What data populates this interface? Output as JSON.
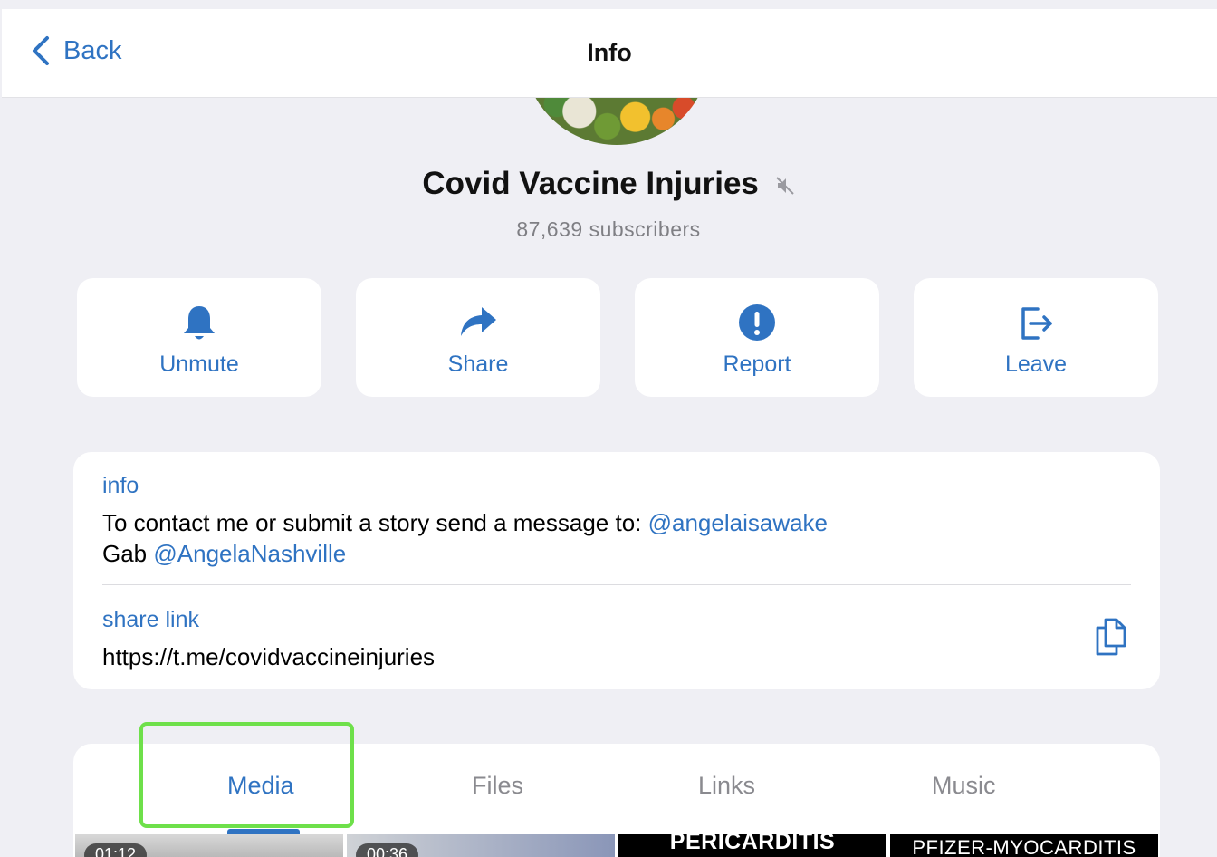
{
  "navbar": {
    "back_label": "Back",
    "title": "Info"
  },
  "channel": {
    "name": "Covid Vaccine Injuries",
    "subscribers": "87,639 subscribers",
    "muted": true
  },
  "actions": [
    {
      "label": "Unmute",
      "icon": "bell-icon"
    },
    {
      "label": "Share",
      "icon": "share-arrow-icon"
    },
    {
      "label": "Report",
      "icon": "exclamation-icon"
    },
    {
      "label": "Leave",
      "icon": "leave-icon"
    }
  ],
  "info": {
    "label": "info",
    "line1_text": "To contact me or submit a story send a message to: ",
    "line1_mention": "@angelaisawake",
    "line2_text": "Gab ",
    "line2_mention": "@AngelaNashville"
  },
  "share_link": {
    "label": "share link",
    "url": "https://t.me/covidvaccineinjuries"
  },
  "tabs": [
    {
      "label": "Media",
      "active": true
    },
    {
      "label": "Files",
      "active": false
    },
    {
      "label": "Links",
      "active": false
    },
    {
      "label": "Music",
      "active": false
    }
  ],
  "media_thumbs": [
    {
      "duration": "01:12"
    },
    {
      "duration": "00:36"
    },
    {
      "caption": "PERICARDITIS"
    },
    {
      "caption": "PFIZER-MYOCARDITIS"
    }
  ],
  "colors": {
    "accent": "#2f73c2",
    "background": "#efeff4",
    "highlight": "#6ee04a"
  }
}
